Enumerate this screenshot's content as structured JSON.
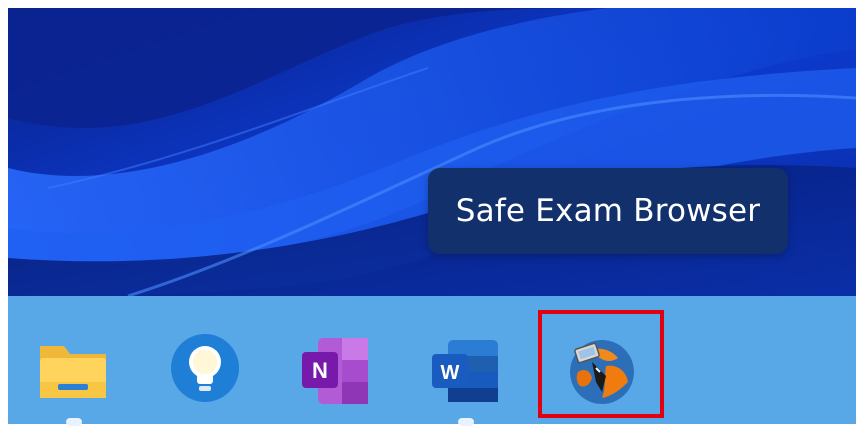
{
  "tooltip": {
    "text": "Safe Exam Browser"
  },
  "taskbar": {
    "apps": [
      {
        "name": "File Explorer",
        "icon": "folder-icon",
        "running": true
      },
      {
        "name": "Tips",
        "icon": "lightbulb-icon",
        "running": false
      },
      {
        "name": "OneNote",
        "icon": "onenote-icon",
        "icon_letter": "N",
        "running": false
      },
      {
        "name": "Word",
        "icon": "word-icon",
        "icon_letter": "W",
        "running": true
      },
      {
        "name": "Safe Exam Browser",
        "icon": "safe-exam-browser-icon",
        "running": false,
        "highlighted": true
      }
    ]
  },
  "colors": {
    "wallpaper_base": "#0b2fa8",
    "taskbar": "#58a8e8",
    "tooltip_bg": "#12306b",
    "highlight": "#e00010"
  }
}
